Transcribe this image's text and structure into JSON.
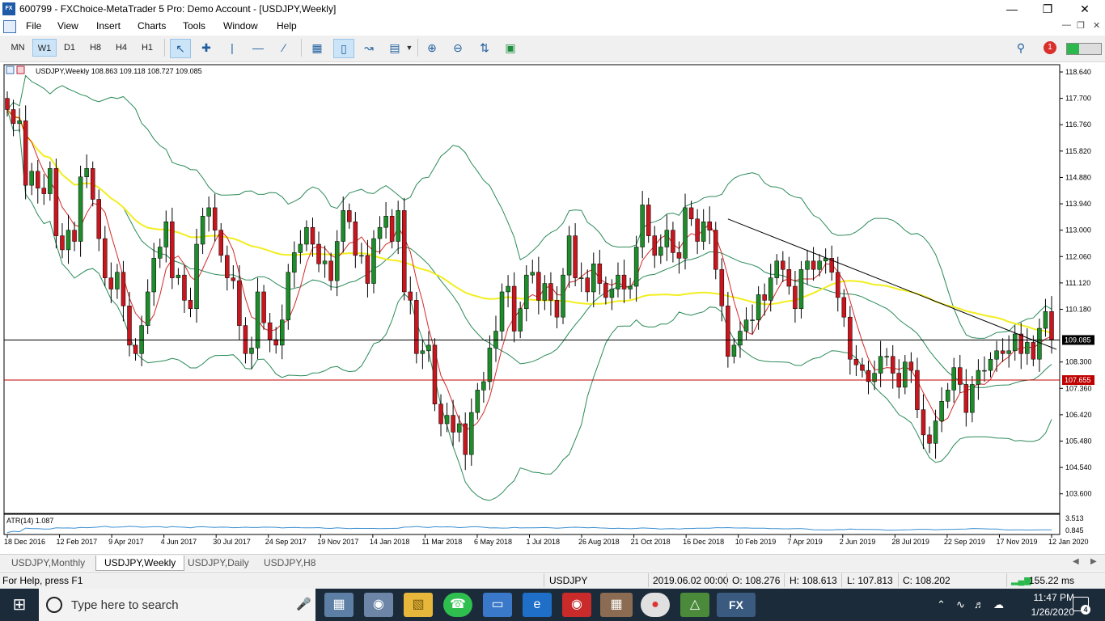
{
  "window": {
    "title": "600799 - FXChoice-MetaTrader 5 Pro: Demo Account - [USDJPY,Weekly]",
    "logo": "FX"
  },
  "menu": [
    "File",
    "View",
    "Insert",
    "Charts",
    "Tools",
    "Window",
    "Help"
  ],
  "timeframes": [
    "MN",
    "W1",
    "D1",
    "H8",
    "H4",
    "H1"
  ],
  "active_timeframe": "W1",
  "toolbar_icons": [
    "cursor-icon",
    "crosshair-icon",
    "vertical-line-icon",
    "horizontal-line-icon",
    "trendline-icon",
    "bar-chart-icon",
    "candlestick-icon",
    "line-chart-icon",
    "indicators-icon",
    "zoom-in-icon",
    "zoom-out-icon",
    "autoscroll-icon",
    "chart-shift-icon"
  ],
  "notifications": {
    "count": "1"
  },
  "connection_strength": 0.35,
  "chart": {
    "header": "USDJPY,Weekly   108.863 109.118 108.727 109.085",
    "current_price": "109.085",
    "horizontal_line": "107.655",
    "indicator_label": "ATR(14) 1.087",
    "indicator_ticks": [
      "3.513",
      "0.845"
    ],
    "colors": {
      "bull": "#1e8c2a",
      "bear": "#c8161e",
      "ma_fast": "#d42a2a",
      "ma_slow": "#f2ee20",
      "bands": "#2b8a58",
      "hline": "#c00000"
    }
  },
  "chart_data": {
    "type": "candlestick",
    "symbol": "USDJPY",
    "timeframe": "Weekly",
    "y_ticks": [
      "118.640",
      "117.700",
      "116.760",
      "115.820",
      "114.880",
      "113.940",
      "113.000",
      "112.060",
      "111.120",
      "110.180",
      "108.300",
      "107.360",
      "106.420",
      "105.480",
      "104.540",
      "103.600"
    ],
    "ylim": [
      102.9,
      118.9
    ],
    "x_ticks": [
      "18 Dec 2016",
      "12 Feb 2017",
      "9 Apr 2017",
      "4 Jun 2017",
      "30 Jul 2017",
      "24 Sep 2017",
      "19 Nov 2017",
      "14 Jan 2018",
      "11 Mar 2018",
      "6 May 2018",
      "1 Jul 2018",
      "26 Aug 2018",
      "21 Oct 2018",
      "16 Dec 2018",
      "10 Feb 2019",
      "7 Apr 2019",
      "2 Jun 2019",
      "28 Jul 2019",
      "22 Sep 2019",
      "17 Nov 2019",
      "12 Jan 2020"
    ],
    "closes": [
      117.3,
      116.8,
      116.9,
      114.6,
      115.1,
      114.5,
      114.3,
      115.2,
      112.8,
      112.3,
      113.0,
      112.6,
      114.9,
      115.2,
      114.1,
      112.7,
      111.3,
      110.9,
      111.5,
      110.3,
      108.9,
      108.6,
      109.6,
      110.8,
      112.0,
      112.4,
      113.3,
      111.3,
      111.4,
      110.5,
      110.2,
      112.5,
      113.5,
      113.8,
      113.0,
      112.1,
      111.3,
      111.2,
      109.6,
      108.6,
      108.8,
      110.8,
      109.7,
      109.1,
      108.9,
      109.8,
      111.5,
      112.2,
      112.5,
      113.1,
      112.5,
      111.8,
      111.9,
      111.2,
      112.6,
      113.7,
      113.3,
      112.1,
      112.1,
      111.1,
      112.7,
      113.1,
      113.5,
      112.6,
      113.7,
      110.8,
      110.5,
      108.6,
      108.7,
      108.9,
      106.8,
      106.1,
      106.4,
      105.8,
      106.1,
      105.0,
      106.5,
      107.3,
      107.6,
      108.8,
      109.4,
      110.8,
      111.0,
      109.4,
      110.2,
      111.4,
      111.5,
      110.5,
      111.1,
      110.5,
      109.9,
      111.4,
      112.8,
      111.3,
      111.3,
      110.8,
      111.8,
      111.1,
      110.6,
      110.9,
      111.4,
      110.9,
      111.0,
      112.4,
      113.9,
      112.8,
      112.1,
      112.4,
      113.0,
      112.2,
      112.0,
      113.8,
      113.4,
      112.6,
      113.3,
      113.0,
      111.6,
      110.3,
      108.5,
      108.9,
      109.4,
      109.8,
      109.8,
      110.7,
      110.5,
      111.3,
      111.9,
      111.6,
      111.0,
      110.2,
      111.6,
      111.9,
      111.6,
      111.9,
      112.0,
      111.5,
      110.6,
      109.9,
      108.4,
      108.2,
      108.0,
      107.6,
      107.9,
      108.5,
      108.5,
      107.9,
      107.4,
      108.3,
      108.0,
      106.6,
      105.7,
      105.4,
      106.2,
      106.9,
      107.3,
      108.1,
      107.5,
      106.5,
      107.5,
      108.0,
      108.0,
      108.4,
      108.7,
      108.6,
      108.7,
      109.3,
      108.6,
      109.0,
      108.4,
      109.5,
      110.1,
      109.1
    ]
  },
  "tabs": [
    "USDJPY,Monthly",
    "USDJPY,Weekly",
    "USDJPY,Daily",
    "USDJPY,H8"
  ],
  "active_tab": "USDJPY,Weekly",
  "status": {
    "help": "For Help, press F1",
    "symbol": "USDJPY",
    "datetime": "2019.06.02 00:00",
    "open": "O: 108.276",
    "high": "H: 108.613",
    "low": "L: 107.813",
    "close": "C: 108.202",
    "ping": "155.22 ms"
  },
  "taskbar": {
    "search_placeholder": "Type here to search",
    "time": "11:47 PM",
    "date": "1/26/2020",
    "notification_count": "4",
    "fx_label": "FX"
  }
}
